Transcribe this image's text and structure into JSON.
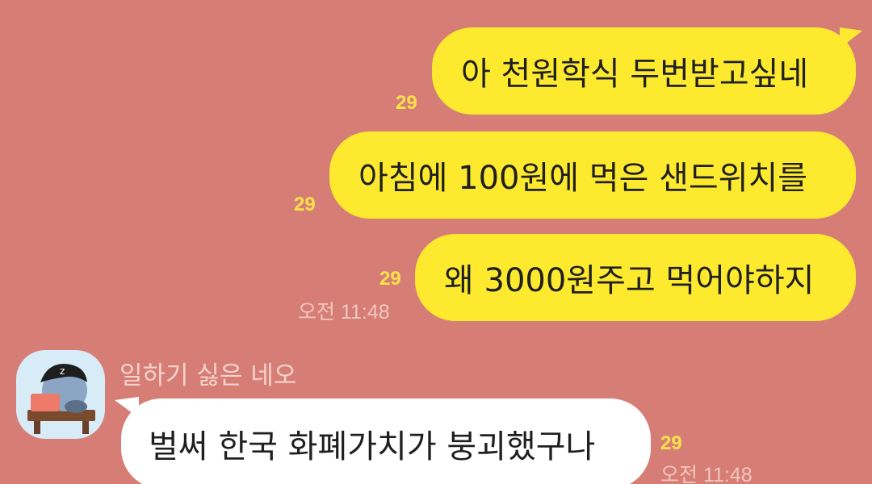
{
  "sent_messages": [
    {
      "text": "아 천원학식 두번받고싶네",
      "unread": "29"
    },
    {
      "text": "아침에 100원에 먹은 샌드위치를",
      "unread": "29"
    },
    {
      "text": "왜 3000원주고 먹어야하지",
      "unread": "29",
      "time": "오전 11:48"
    }
  ],
  "received": {
    "sender_name": "일하기 싫은 네오",
    "avatar_icon": "neo-character-avatar",
    "message": "벌써 한국 화폐가치가 붕괴했구나",
    "unread": "29",
    "time": "오전 11:48"
  },
  "colors": {
    "background": "#d67e76",
    "my_bubble": "#fdea2f",
    "their_bubble": "#ffffff",
    "unread": "#fbe14c"
  }
}
